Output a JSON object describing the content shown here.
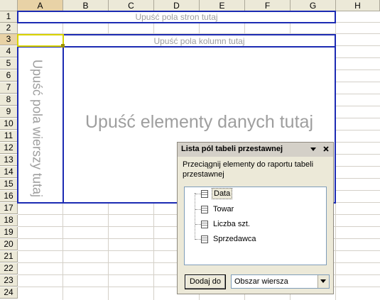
{
  "spreadsheet": {
    "columns": [
      "A",
      "B",
      "C",
      "D",
      "E",
      "F",
      "G",
      "H"
    ],
    "rows": [
      "1",
      "2",
      "3",
      "4",
      "5",
      "6",
      "7",
      "8",
      "9",
      "10",
      "11",
      "12",
      "13",
      "14",
      "15",
      "16",
      "17",
      "18",
      "19",
      "20",
      "21",
      "22",
      "23",
      "24"
    ],
    "selected_column": "A",
    "selected_row": "3"
  },
  "pivot": {
    "page_drop": "Upuść pola stron tutaj",
    "column_drop": "Upuść pola kolumn tutaj",
    "row_drop": "Upuść pola wierszy tutaj",
    "data_drop": "Upuść elementy danych tutaj"
  },
  "field_list": {
    "title": "Lista pól tabeli przestawnej",
    "description": "Przeciągnij elementy do raportu tabeli przestawnej",
    "fields": [
      "Data",
      "Towar",
      "Liczba szt.",
      "Sprzedawca"
    ],
    "selected_field": "Data",
    "add_button": "Dodaj do",
    "area_value": "Obszar wiersza",
    "icons": {
      "menu": "dropdown-arrow-icon",
      "close": "close-icon",
      "field": "field-icon"
    }
  },
  "colors": {
    "drop_border": "#1c2bb3",
    "drop_text": "#9e9e9e",
    "active_cell": "#d9d400"
  }
}
